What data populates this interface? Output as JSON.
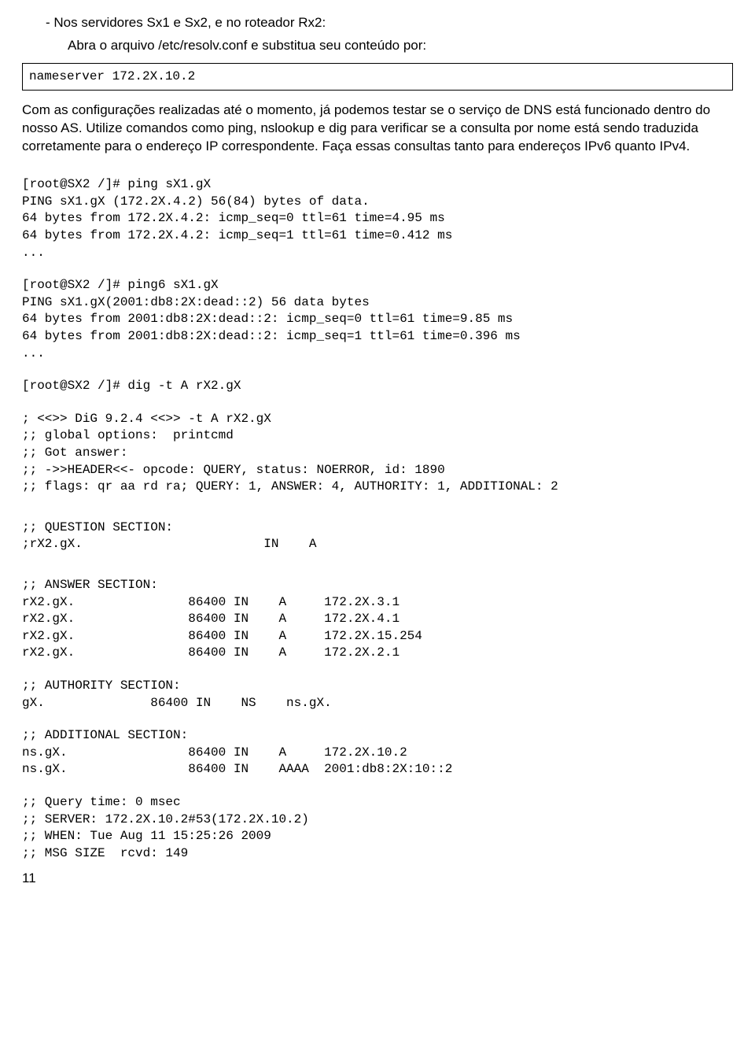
{
  "intro": {
    "line1": "- Nos servidores Sx1 e Sx2, e no roteador Rx2:",
    "line2": "Abra o arquivo /etc/resolv.conf e substitua seu conteúdo por:"
  },
  "codebox1": "nameserver 172.2X.10.2",
  "para1": "Com as configurações realizadas até o momento, já podemos testar se o serviço de DNS está funcionado dentro do nosso AS. Utilize comandos como ping, nslookup e dig para verificar se a consulta por nome está sendo traduzida corretamente para o endereço IP correspondente. Faça essas consultas tanto para endereços IPv6 quanto IPv4.",
  "block1": "[root@SX2 /]# ping sX1.gX\nPING sX1.gX (172.2X.4.2) 56(84) bytes of data.\n64 bytes from 172.2X.4.2: icmp_seq=0 ttl=61 time=4.95 ms\n64 bytes from 172.2X.4.2: icmp_seq=1 ttl=61 time=0.412 ms\n...",
  "block2": "[root@SX2 /]# ping6 sX1.gX\nPING sX1.gX(2001:db8:2X:dead::2) 56 data bytes\n64 bytes from 2001:db8:2X:dead::2: icmp_seq=0 ttl=61 time=9.85 ms\n64 bytes from 2001:db8:2X:dead::2: icmp_seq=1 ttl=61 time=0.396 ms\n...",
  "block3": "[root@SX2 /]# dig -t A rX2.gX",
  "block4": "; <<>> DiG 9.2.4 <<>> -t A rX2.gX\n;; global options:  printcmd\n;; Got answer:\n;; ->>HEADER<<- opcode: QUERY, status: NOERROR, id: 1890\n;; flags: qr aa rd ra; QUERY: 1, ANSWER: 4, AUTHORITY: 1, ADDITIONAL: 2",
  "block5": ";; QUESTION SECTION:\n;rX2.gX.                        IN    A",
  "block6": ";; ANSWER SECTION:\nrX2.gX.               86400 IN    A     172.2X.3.1\nrX2.gX.               86400 IN    A     172.2X.4.1\nrX2.gX.               86400 IN    A     172.2X.15.254\nrX2.gX.               86400 IN    A     172.2X.2.1",
  "block7": ";; AUTHORITY SECTION:\ngX.              86400 IN    NS    ns.gX.",
  "block8": ";; ADDITIONAL SECTION:\nns.gX.                86400 IN    A     172.2X.10.2\nns.gX.                86400 IN    AAAA  2001:db8:2X:10::2",
  "block9": ";; Query time: 0 msec\n;; SERVER: 172.2X.10.2#53(172.2X.10.2)\n;; WHEN: Tue Aug 11 15:25:26 2009\n;; MSG SIZE  rcvd: 149",
  "page_number": "11"
}
